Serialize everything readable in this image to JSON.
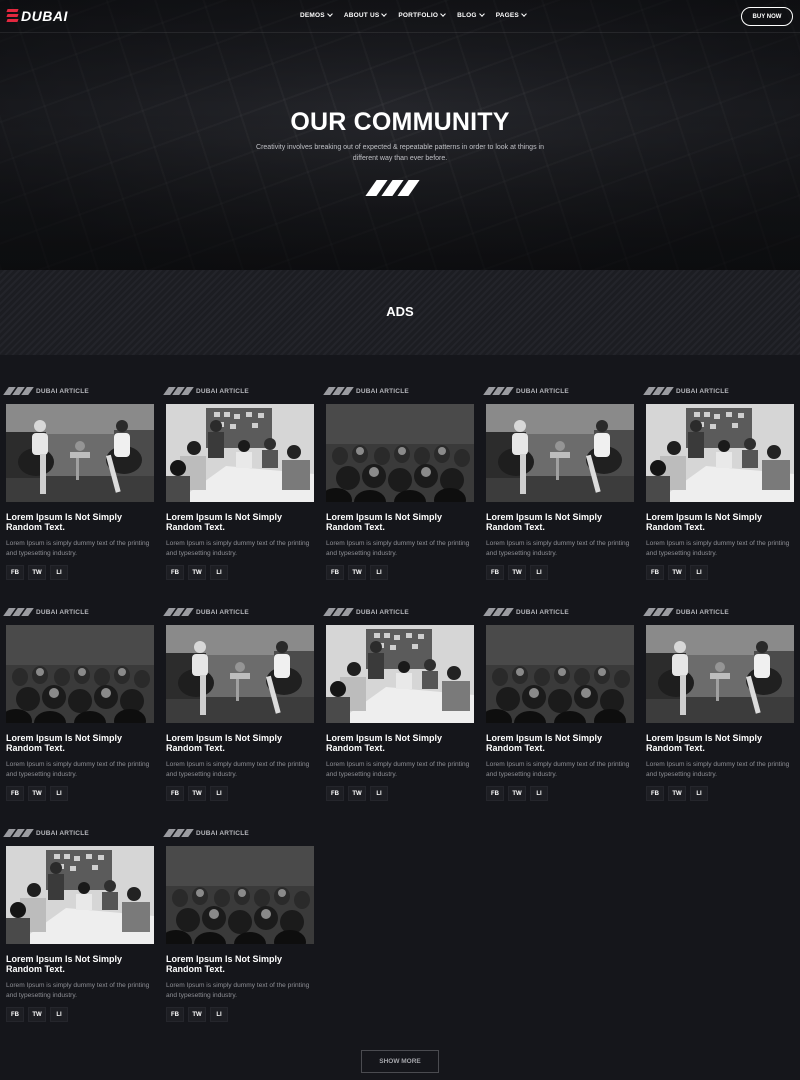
{
  "brand": {
    "name": "DUBAI",
    "accent": "#e3283f"
  },
  "nav": {
    "items": [
      {
        "label": "DEMOS"
      },
      {
        "label": "ABOUT US"
      },
      {
        "label": "PORTFOLIO"
      },
      {
        "label": "BLOG"
      },
      {
        "label": "PAGES"
      }
    ],
    "cta": "BUY NOW"
  },
  "hero": {
    "title": "OUR COMMUNITY",
    "subtitle": "Creativity involves breaking out of expected & repeatable patterns in order to look at things in different way than ever before."
  },
  "section": {
    "title": "ADS"
  },
  "cards": [
    {
      "tag": "DUBAI ARTICLE",
      "image": "interview-photo",
      "title": "Lorem Ipsum Is Not Simply Random Text.",
      "desc": "Lorem Ipsum is simply dummy text of the printing and typesetting industry.",
      "social": [
        "FB",
        "TW",
        "LI"
      ]
    },
    {
      "tag": "DUBAI ARTICLE",
      "image": "meeting-photo",
      "title": "Lorem Ipsum Is Not Simply Random Text.",
      "desc": "Lorem Ipsum is simply dummy text of the printing and typesetting industry.",
      "social": [
        "FB",
        "TW",
        "LI"
      ]
    },
    {
      "tag": "DUBAI ARTICLE",
      "image": "audience-photo",
      "title": "Lorem Ipsum Is Not Simply Random Text.",
      "desc": "Lorem Ipsum is simply dummy text of the printing and typesetting industry.",
      "social": [
        "FB",
        "TW",
        "LI"
      ]
    },
    {
      "tag": "DUBAI ARTICLE",
      "image": "interview-photo",
      "title": "Lorem Ipsum Is Not Simply Random Text.",
      "desc": "Lorem Ipsum is simply dummy text of the printing and typesetting industry.",
      "social": [
        "FB",
        "TW",
        "LI"
      ]
    },
    {
      "tag": "DUBAI ARTICLE",
      "image": "meeting-photo",
      "title": "Lorem Ipsum Is Not Simply Random Text.",
      "desc": "Lorem Ipsum is simply dummy text of the printing and typesetting industry.",
      "social": [
        "FB",
        "TW",
        "LI"
      ]
    },
    {
      "tag": "DUBAI ARTICLE",
      "image": "audience-photo",
      "title": "Lorem Ipsum Is Not Simply Random Text.",
      "desc": "Lorem Ipsum is simply dummy text of the printing and typesetting industry.",
      "social": [
        "FB",
        "TW",
        "LI"
      ]
    },
    {
      "tag": "DUBAI ARTICLE",
      "image": "interview-photo",
      "title": "Lorem Ipsum Is Not Simply Random Text.",
      "desc": "Lorem Ipsum is simply dummy text of the printing and typesetting industry.",
      "social": [
        "FB",
        "TW",
        "LI"
      ]
    },
    {
      "tag": "DUBAI ARTICLE",
      "image": "meeting-photo",
      "title": "Lorem Ipsum Is Not Simply Random Text.",
      "desc": "Lorem Ipsum is simply dummy text of the printing and typesetting industry.",
      "social": [
        "FB",
        "TW",
        "LI"
      ]
    },
    {
      "tag": "DUBAI ARTICLE",
      "image": "audience-photo",
      "title": "Lorem Ipsum Is Not Simply Random Text.",
      "desc": "Lorem Ipsum is simply dummy text of the printing and typesetting industry.",
      "social": [
        "FB",
        "TW",
        "LI"
      ]
    },
    {
      "tag": "DUBAI ARTICLE",
      "image": "interview-photo",
      "title": "Lorem Ipsum Is Not Simply Random Text.",
      "desc": "Lorem Ipsum is simply dummy text of the printing and typesetting industry.",
      "social": [
        "FB",
        "TW",
        "LI"
      ]
    },
    {
      "tag": "DUBAI ARTICLE",
      "image": "meeting-photo",
      "title": "Lorem Ipsum Is Not Simply Random Text.",
      "desc": "Lorem Ipsum is simply dummy text of the printing and typesetting industry.",
      "social": [
        "FB",
        "TW",
        "LI"
      ]
    },
    {
      "tag": "DUBAI ARTICLE",
      "image": "audience-photo",
      "title": "Lorem Ipsum Is Not Simply Random Text.",
      "desc": "Lorem Ipsum is simply dummy text of the printing and typesetting industry.",
      "social": [
        "FB",
        "TW",
        "LI"
      ]
    }
  ],
  "show_more": "SHOW MORE"
}
